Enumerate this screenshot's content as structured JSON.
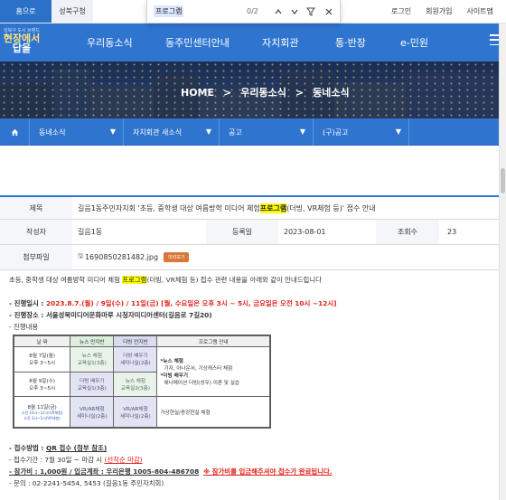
{
  "top": {
    "home": "홈으로",
    "gu": "성북구청",
    "links": [
      "로그인",
      "회원가입",
      "사이트맵"
    ]
  },
  "find": {
    "query": "프로그램",
    "count": "0/2"
  },
  "logo": {
    "line1": "성북구 도시 브랜드",
    "line2": "현장에서",
    "line3": "답을"
  },
  "gnb": [
    "우리동소식",
    "동주민센터안내",
    "자치회관",
    "통·반장",
    "e-민원"
  ],
  "breadcrumb": {
    "home": "HOME",
    "sep": ">",
    "level1": "우리동소식",
    "level2": "동네소식"
  },
  "subnav": [
    "동네소식",
    "자치회관 새소식",
    "공고",
    "(구)공고"
  ],
  "post": {
    "labels": {
      "title": "제목",
      "author": "작성자",
      "date": "등록일",
      "views": "조회수",
      "attach": "첨부파일"
    },
    "title_before": "길음1동주민자치회 '초등, 중학생 대상 여름방학 미디어 체험 ",
    "title_hl": "프로그램",
    "title_after": "(더빙, VR체험 등)' 접수 안내",
    "author": "길음1동",
    "date": "2023-08-01",
    "views": "23",
    "file": "1690850281482.jpg",
    "preview": "미리보기"
  },
  "body": {
    "intro_before": "초등, 중학생 대상 여름방학 미디어 체험 ",
    "intro_hl": "프로그램",
    "intro_after": "(더빙, VR체험 등) 접수 관련 내용을 아래와 같이 안내드립니다",
    "l1_label": "- 진행일시 : ",
    "l1_value": "2023.8.7.(월) / 9일(수) / 11일(금) [월, 수요일은 오후 3시 ~ 5시, 금요일은 오전 10시 ~12시]",
    "l2": "- 진행장소 : 서울성북미디어문화마루 시청자미디어센터(길음로 7길20)",
    "l3": "- 진행내용",
    "apply_label": "- 접수방법 : ",
    "apply_value": "QR 접수 (첨부 참조)",
    "period_label": "- 접수기간 : 7월 30일 ~ 마감 시 ",
    "period_value": "(선착순 마감)",
    "fee": "- 참가비 : 1,000원 / 입금계좌 : 우리은행 1005-804-486708",
    "fee_note": "※ 참가비를 입금해주셔야 접수가 완료됩니다.",
    "contact": "- 문의 : 02-2241-5454, 5453 (길음1동 주민자치회)"
  },
  "schedule": {
    "headers": [
      "날  짜",
      "뉴스 만지반",
      "더빙 만지반",
      "프로그램 안내"
    ],
    "rows": [
      {
        "date": "8월 7일(월)",
        "time": "오후 3~5시",
        "news": "뉴스 체험",
        "news_room": "교육실1(3층)",
        "dub": "더빙 배우기",
        "dub_room": "세미나실(2층)"
      },
      {
        "date": "8월 9일(수)",
        "time": "오후 3~5시",
        "news": "더빙 배우기",
        "news_room": "교육실1(3층)",
        "dub": "뉴스 체험",
        "dub_room": "교육실2(3층)"
      },
      {
        "date": "8월 11일(금)",
        "time": "오후 3~5시",
        "note": "오전 10시~12시(VR체험)",
        "note2": "오후 3시~5시(VR체험)",
        "news": "VR/AR체험",
        "news_room": "세미나실(2층)",
        "dub": "VR/AR체험",
        "dub_room": "세미나실(2층)"
      }
    ],
    "guide": [
      "*뉴스 체험",
      "기자, 아나운서, 기상캐스터 체험",
      "*더빙 배우기",
      "애니메이션 더빙(성우) 이론 및 실습",
      "가상현실/증강현실 체험"
    ]
  }
}
